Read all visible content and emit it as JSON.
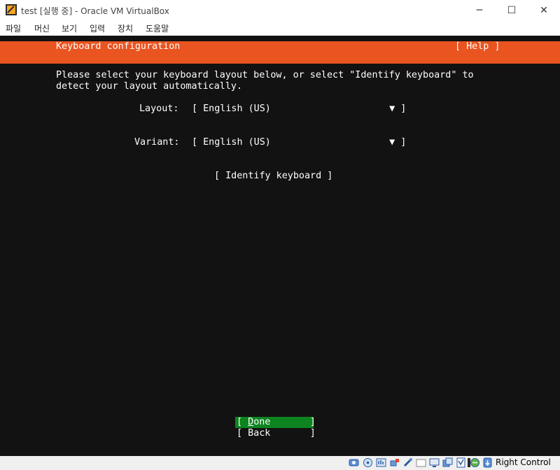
{
  "window": {
    "title": "test [실행 중] - Oracle VM VirtualBox",
    "minimize_glyph": "─",
    "maximize_glyph": "☐",
    "close_glyph": "✕"
  },
  "menu": {
    "items": [
      "파일",
      "머신",
      "보기",
      "입력",
      "장치",
      "도움말"
    ]
  },
  "installer": {
    "header_title": "Keyboard configuration",
    "help_label": "[ Help ]",
    "intro_line1": "Please select your keyboard layout below, or select \"Identify keyboard\" to",
    "intro_line2": "detect your layout automatically.",
    "layout_label": "Layout:",
    "layout_value": "[ English (US)                     ▼ ]",
    "variant_label": "Variant:",
    "variant_value": "[ English (US)                     ▼ ]",
    "identify_button": "[ Identify keyboard ]",
    "done_open": "[ ",
    "done_hotkey": "D",
    "done_rest": "one       ]",
    "back_button": "[ Back       ]"
  },
  "statusbar": {
    "icons": [
      "hard-disk-icon",
      "optical-drive-icon",
      "audio-icon",
      "network-icon",
      "usb-icon",
      "shared-folders-icon",
      "display-icon",
      "video-capture-icon",
      "recording-icon",
      "virtualization-icon",
      "cpu-icon",
      "mouse-integration-icon",
      "keyboard-icon"
    ],
    "host_key": "Right Control"
  },
  "colors": {
    "accent": "#e95420",
    "selected_button": "#0e8420",
    "vm_background": "#121212"
  }
}
